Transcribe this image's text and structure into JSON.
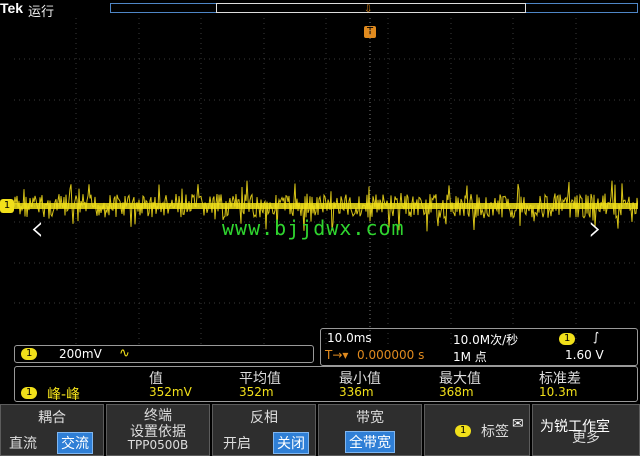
{
  "header": {
    "brand": "Tek",
    "run_state": "运行"
  },
  "trigger": {
    "marker_glyph": "⇩",
    "badge": "T"
  },
  "channel": {
    "ch1_label": "1",
    "scale": "200mV",
    "coupling_symbol": "∿"
  },
  "watermark": {
    "url": "www.bjjdwx.com",
    "note": "为锐工作室"
  },
  "nav": {
    "prev": "‹",
    "next": "›"
  },
  "timebase": {
    "horizontal_scale": "10.0ms",
    "sample_rate": "10.0M次/秒",
    "trigger_source": "1",
    "trigger_slope": "∫",
    "position_prefix": "T→▾",
    "position": "0.000000 s",
    "record_length": "1M 点",
    "trigger_level": "1.60 V"
  },
  "measurement": {
    "source_badge": "1",
    "type": "峰-峰",
    "headers": [
      "值",
      "平均值",
      "最小值",
      "最大值",
      "标准差"
    ],
    "values": [
      "352mV",
      "352m",
      "336m",
      "368m",
      "10.3m"
    ]
  },
  "menu": {
    "coupling": {
      "title": "耦合",
      "opt1": "直流",
      "opt2": "交流"
    },
    "termination": {
      "title": "终端",
      "subtitle": "设置依据",
      "probe": "TPP0500B"
    },
    "invert": {
      "title": "反相",
      "opt1": "开启",
      "opt2": "关闭"
    },
    "bandwidth": {
      "title": "带宽",
      "value": "全带宽"
    },
    "label": {
      "badge": "1",
      "title": "标签"
    },
    "more": {
      "title": "更多"
    }
  },
  "colors": {
    "ch1": "#f1e01a",
    "trigger": "#e08a1e",
    "selected": "#2f7fd6",
    "watermark": "#2fd52f"
  }
}
